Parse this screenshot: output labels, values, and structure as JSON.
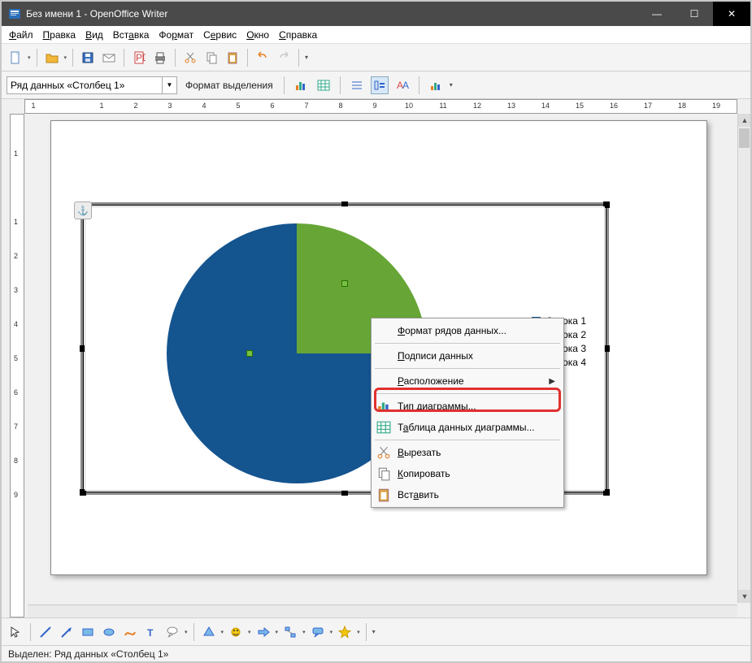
{
  "window": {
    "title": "Без имени 1 - OpenOffice Writer",
    "minimize": "—",
    "maximize": "☐",
    "close": "✕"
  },
  "menubar": [
    {
      "pre": "",
      "ul": "Ф",
      "post": "айл"
    },
    {
      "pre": "",
      "ul": "П",
      "post": "равка"
    },
    {
      "pre": "",
      "ul": "В",
      "post": "ид"
    },
    {
      "pre": "Вст",
      "ul": "а",
      "post": "вка"
    },
    {
      "pre": "Фо",
      "ul": "р",
      "post": "мат"
    },
    {
      "pre": "С",
      "ul": "е",
      "post": "рвис"
    },
    {
      "pre": "",
      "ul": "О",
      "post": "кно"
    },
    {
      "pre": "",
      "ul": "С",
      "post": "правка"
    }
  ],
  "toolbar2": {
    "combo_value": "Ряд данных «Столбец 1»",
    "format_label": "Формат выделения"
  },
  "ruler_h": [
    "1",
    "",
    "1",
    "2",
    "3",
    "4",
    "5",
    "6",
    "7",
    "8",
    "9",
    "10",
    "11",
    "12",
    "13",
    "14",
    "15",
    "16",
    "17",
    "18",
    "19"
  ],
  "ruler_v": [
    "",
    "1",
    "",
    "1",
    "2",
    "3",
    "4",
    "5",
    "6",
    "7",
    "8",
    "9"
  ],
  "chart_data": {
    "type": "pie",
    "series_name": "Столбец 1",
    "categories": [
      "Строка 1",
      "Строка 2",
      "Строка 3",
      "Строка 4"
    ],
    "values": [
      75,
      0,
      0,
      25
    ],
    "colors": [
      "#14548f",
      "#e8420c",
      "#f2c80f",
      "#67a636"
    ],
    "legend_position": "right"
  },
  "legend": [
    {
      "label": "Строка 1",
      "color": "#14548f"
    },
    {
      "label": "Строка 2",
      "color": "#e8420c"
    },
    {
      "label": "Строка 3",
      "color": "#f2c80f"
    },
    {
      "label": "Строка 4",
      "color": "#67a636"
    }
  ],
  "context_menu": {
    "format_series": {
      "pre": "",
      "ul": "Ф",
      "post": "ормат рядов данных..."
    },
    "data_labels": {
      "pre": "",
      "ul": "П",
      "post": "одписи данных"
    },
    "arrangement": {
      "pre": "",
      "ul": "Р",
      "post": "асположение"
    },
    "chart_type": {
      "pre": "",
      "ul": "Т",
      "post": "ип диаграммы..."
    },
    "data_table": {
      "pre": "Т",
      "ul": "а",
      "post": "блица данных диаграммы..."
    },
    "cut": {
      "pre": "",
      "ul": "В",
      "post": "ырезать"
    },
    "copy": {
      "pre": "",
      "ul": "К",
      "post": "опировать"
    },
    "paste": {
      "pre": "Вст",
      "ul": "а",
      "post": "вить"
    },
    "submenu_arrow": "▶"
  },
  "statusbar": {
    "text": "Выделен: Ряд данных «Столбец 1»"
  }
}
